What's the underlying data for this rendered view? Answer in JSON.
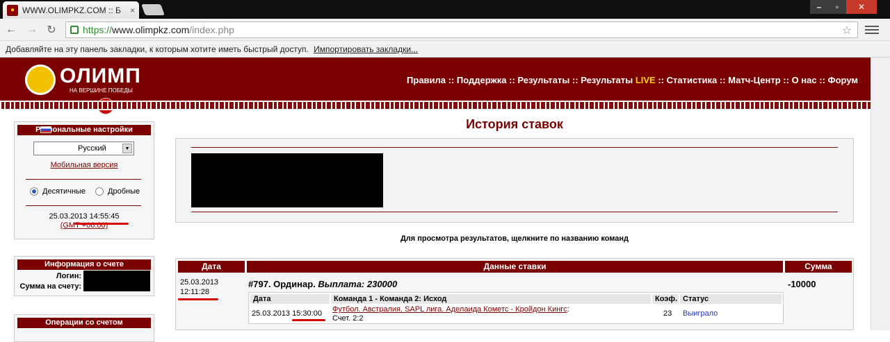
{
  "browser": {
    "tab_title": "WWW.OLIMPKZ.COM :: Б",
    "tab_close": "×",
    "url_proto": "https://",
    "url_host": "www.olimpkz.com",
    "url_path": "/index.php",
    "bookmarks_text": "Добавляйте на эту панель закладки, к которым хотите иметь быстрый доступ.",
    "bookmarks_link": "Импортировать закладки..."
  },
  "header": {
    "logo_name": "ОЛИМП",
    "logo_slogan": "НА ВЕРШИНЕ ПОБЕДЫ",
    "nav": [
      {
        "label": "Правила"
      },
      {
        "label": "Поддержка"
      },
      {
        "label": "Результаты"
      },
      {
        "label": "Результаты",
        "live": "LIVE"
      },
      {
        "label": "Статистика"
      },
      {
        "label": "Матч-Центр"
      },
      {
        "label": "О нас"
      },
      {
        "label": "Форум"
      }
    ],
    "separator": " :: "
  },
  "region": {
    "title": "Региональные настройки",
    "language": "Русский",
    "mobile_link": "Мобильная версия",
    "odds_decimal": "Десятичные",
    "odds_fraction": "Дробные",
    "date": "25.03.2013",
    "time": "14:55:45",
    "gmt": "(GMT +06:00)"
  },
  "account": {
    "title": "Информация о счете",
    "login_label": "Логин:",
    "balance_label": "Сумма на счету:"
  },
  "operations": {
    "title": "Операции со счетом"
  },
  "main": {
    "title": "История ставок",
    "hint": "Для просмотра результатов, щелкните по названию команд"
  },
  "bets": {
    "col_date": "Дата",
    "col_data": "Данные ставки",
    "col_sum": "Сумма",
    "row": {
      "date": "25.03.2013",
      "time": "12:11:28",
      "title": "#797. Ординар.",
      "payout": "Выплата: 230000",
      "sum": "-10000",
      "inner_headers": {
        "date": "Дата",
        "match": "Команда 1 - Команда 2: Исход",
        "coef": "Коэф.",
        "status": "Статус"
      },
      "event": {
        "date": "25.03.2013",
        "time": "15:30:00",
        "match": "Футбол. Австралия. SAPL лига. Аделаида Кометс - Кройдон Кингс",
        "score": "Счет. 2:2",
        "coef": "23",
        "status": "Выиграло"
      }
    }
  }
}
